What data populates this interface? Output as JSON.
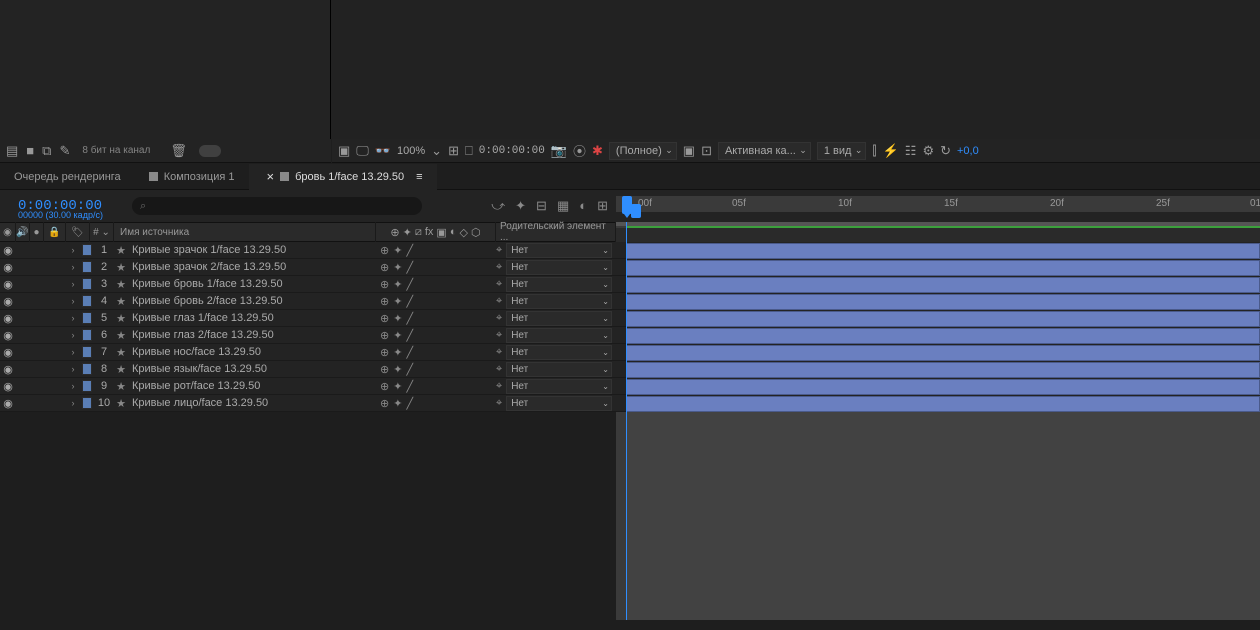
{
  "project_toolbar": {
    "bpc": "8 бит на канал"
  },
  "comp_toolbar": {
    "zoom": "100%",
    "timecode": "0:00:00:00",
    "resolution": "(Полное)",
    "camera": "Активная ка...",
    "view": "1 вид",
    "offset": "+0,0"
  },
  "tabs": [
    {
      "label": "Очередь рендеринга",
      "icon": false
    },
    {
      "label": "Композиция 1",
      "icon": true
    },
    {
      "label": "бровь 1/face 13.29.50",
      "icon": true,
      "active": true
    }
  ],
  "timeline": {
    "timecode": "0:00:00:00",
    "framerate": "00000 (30.00 кадр/с)",
    "search_placeholder": "",
    "columns": {
      "name": "Имя источника",
      "parent": "Родительский элемент ..."
    },
    "ruler": [
      "00f",
      "05f",
      "10f",
      "15f",
      "20f",
      "25f",
      "01"
    ]
  },
  "layers": [
    {
      "num": 1,
      "name": "Кривые зрачок 1/face 13.29.50",
      "parent": "Нет"
    },
    {
      "num": 2,
      "name": "Кривые зрачок 2/face 13.29.50",
      "parent": "Нет"
    },
    {
      "num": 3,
      "name": "Кривые бровь 1/face 13.29.50",
      "parent": "Нет"
    },
    {
      "num": 4,
      "name": "Кривые бровь 2/face 13.29.50",
      "parent": "Нет"
    },
    {
      "num": 5,
      "name": "Кривые глаз 1/face 13.29.50",
      "parent": "Нет"
    },
    {
      "num": 6,
      "name": "Кривые глаз 2/face 13.29.50",
      "parent": "Нет"
    },
    {
      "num": 7,
      "name": "Кривые нос/face 13.29.50",
      "parent": "Нет"
    },
    {
      "num": 8,
      "name": "Кривые язык/face 13.29.50",
      "parent": "Нет"
    },
    {
      "num": 9,
      "name": "Кривые рот/face 13.29.50",
      "parent": "Нет"
    },
    {
      "num": 10,
      "name": "Кривые лицо/face 13.29.50",
      "parent": "Нет"
    }
  ]
}
